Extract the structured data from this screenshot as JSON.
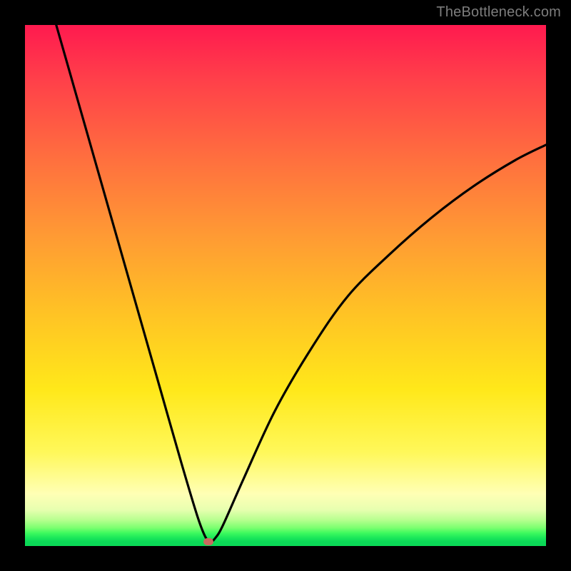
{
  "watermark": "TheBottleneck.com",
  "chart_data": {
    "type": "line",
    "title": "",
    "xlabel": "",
    "ylabel": "",
    "xlim": [
      0,
      100
    ],
    "ylim": [
      0,
      100
    ],
    "series": [
      {
        "name": "bottleneck-curve",
        "x": [
          6,
          10,
          14,
          18,
          22,
          26,
          30,
          33,
          34.5,
          35.5,
          36.5,
          38,
          42,
          48,
          55,
          62,
          70,
          78,
          86,
          94,
          100
        ],
        "y": [
          100,
          86,
          72,
          58,
          44,
          30,
          16,
          6,
          2,
          0.8,
          1.5,
          4,
          13,
          26,
          38,
          48,
          56,
          63,
          69,
          74,
          77
        ]
      }
    ],
    "marker": {
      "x": 35.2,
      "y": 0.8,
      "color": "#c96a5f"
    },
    "gradient_stops": [
      {
        "pct": 0,
        "color": "#ff1a4f"
      },
      {
        "pct": 25,
        "color": "#ff6d3f"
      },
      {
        "pct": 55,
        "color": "#ffc225"
      },
      {
        "pct": 82,
        "color": "#fff85a"
      },
      {
        "pct": 95,
        "color": "#b7ff8f"
      },
      {
        "pct": 100,
        "color": "#0bd957"
      }
    ]
  }
}
